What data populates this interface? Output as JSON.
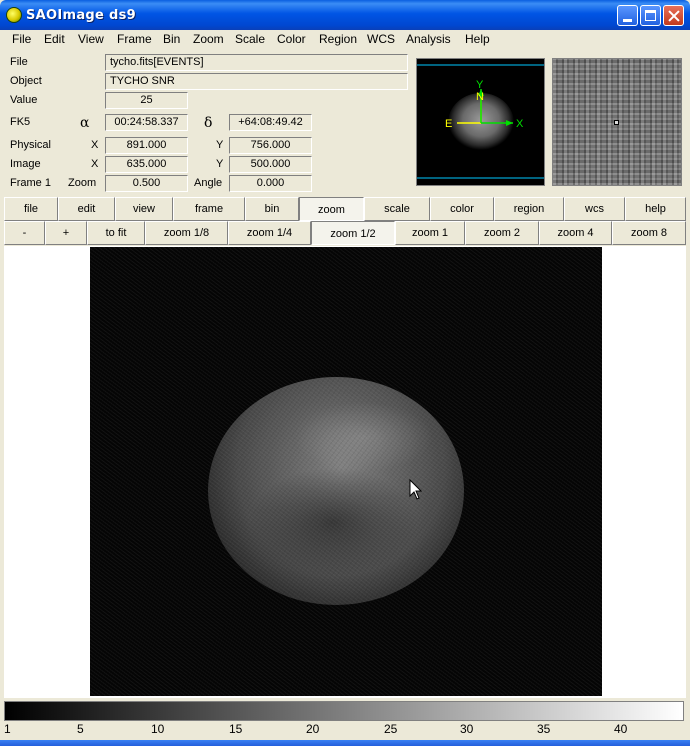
{
  "window": {
    "title": "SAOImage ds9"
  },
  "menu": [
    "File",
    "Edit",
    "View",
    "Frame",
    "Bin",
    "Zoom",
    "Scale",
    "Color",
    "Region",
    "WCS",
    "Analysis",
    "Help"
  ],
  "info": {
    "file_label": "File",
    "file_value": "tycho.fits[EVENTS]",
    "object_label": "Object",
    "object_value": "TYCHO SNR",
    "value_label": "Value",
    "value_value": "25",
    "fk5_label": "FK5",
    "alpha_symbol": "α",
    "alpha_value": "00:24:58.337",
    "delta_symbol": "δ",
    "delta_value": "+64:08:49.42",
    "physical_label": "Physical",
    "physical_x_label": "X",
    "physical_x": "891.000",
    "physical_y_label": "Y",
    "physical_y": "756.000",
    "image_label": "Image",
    "image_x_label": "X",
    "image_x": "635.000",
    "image_y_label": "Y",
    "image_y": "500.000",
    "frame_label": "Frame 1",
    "zoom_label": "Zoom",
    "zoom_value": "0.500",
    "angle_label": "Angle",
    "angle_value": "0.000"
  },
  "panner": {
    "compass_n": "N",
    "compass_e": "E",
    "axis_x": "X",
    "axis_y": "Y"
  },
  "buttonbar_main": [
    "file",
    "edit",
    "view",
    "frame",
    "bin",
    "zoom",
    "scale",
    "color",
    "region",
    "wcs",
    "help"
  ],
  "buttonbar_main_active": "zoom",
  "buttonbar_zoom": [
    "-",
    "+",
    "to fit",
    "zoom 1/8",
    "zoom 1/4",
    "zoom 1/2",
    "zoom 1",
    "zoom 2",
    "zoom 4",
    "zoom 8"
  ],
  "buttonbar_zoom_active": "zoom 1/2",
  "colorbar": {
    "ticks": [
      "1",
      "5",
      "10",
      "15",
      "20",
      "25",
      "30",
      "35",
      "40"
    ],
    "range": [
      1,
      44
    ]
  },
  "colors": {
    "titlebar": "#0055e5",
    "chrome": "#ece9d8",
    "compass_green": "#00e000",
    "compass_yellow": "#ffff00",
    "panner_frame": "#00c8ff"
  }
}
